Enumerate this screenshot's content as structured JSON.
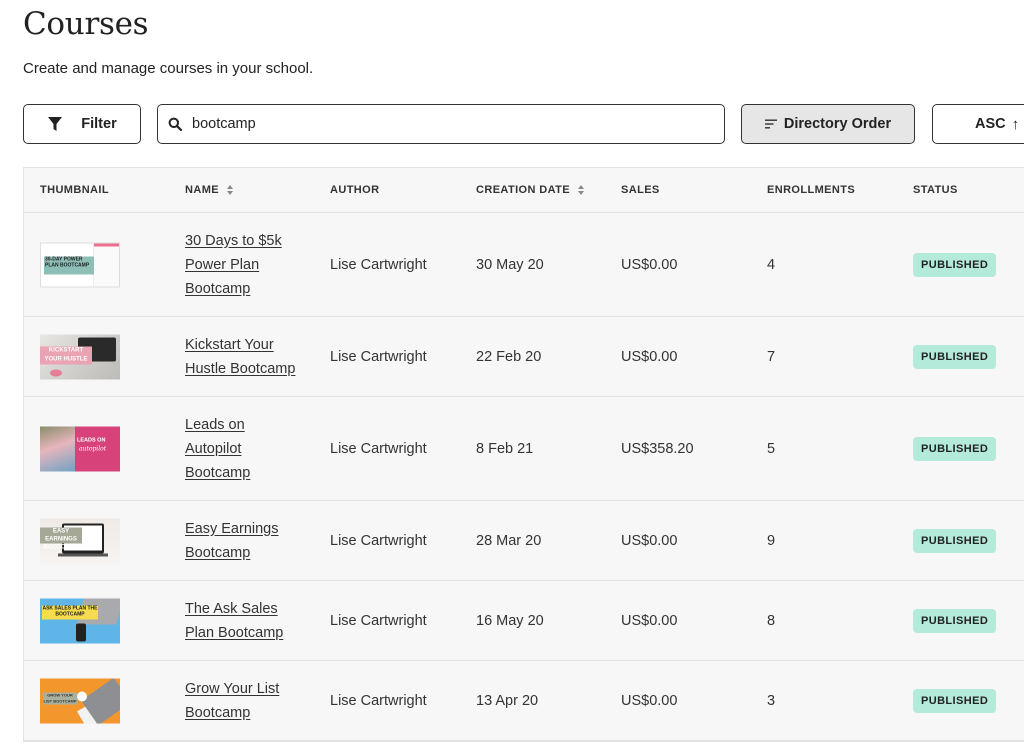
{
  "header": {
    "title": "Courses",
    "subtitle": "Create and manage courses in your school."
  },
  "toolbar": {
    "filter_label": "Filter",
    "search_value": "bootcamp",
    "search_placeholder": "Search",
    "order_label": "Directory Order",
    "direction_label": "ASC",
    "direction_arrow": "↑"
  },
  "table": {
    "columns": {
      "thumbnail": "THUMBNAIL",
      "name": "NAME",
      "author": "AUTHOR",
      "creation_date": "CREATION DATE",
      "sales": "SALES",
      "enrollments": "ENROLLMENTS",
      "status": "STATUS"
    },
    "rows": [
      {
        "name": "30 Days to $5k Power Plan Bootcamp",
        "author": "Lise Cartwright",
        "date": "30 May 20",
        "sales": "US$0.00",
        "enrollments": "4",
        "status": "PUBLISHED",
        "thumb_text": "30-DAY POWER PLAN BOOTCAMP"
      },
      {
        "name": "Kickstart Your Hustle Bootcamp",
        "author": "Lise Cartwright",
        "date": "22 Feb 20",
        "sales": "US$0.00",
        "enrollments": "7",
        "status": "PUBLISHED",
        "thumb_text": "KICKSTART YOUR HUSTLE"
      },
      {
        "name": "Leads on Autopilot Bootcamp",
        "author": "Lise Cartwright",
        "date": "8 Feb 21",
        "sales": "US$358.20",
        "enrollments": "5",
        "status": "PUBLISHED",
        "thumb_text": "LEADS ON",
        "thumb_text2": "autopilot"
      },
      {
        "name": "Easy Earnings Bootcamp",
        "author": "Lise Cartwright",
        "date": "28 Mar 20",
        "sales": "US$0.00",
        "enrollments": "9",
        "status": "PUBLISHED",
        "thumb_text": "EASY EARNINGS BOOTCAMP"
      },
      {
        "name": "The Ask Sales Plan Bootcamp",
        "author": "Lise Cartwright",
        "date": "16 May 20",
        "sales": "US$0.00",
        "enrollments": "8",
        "status": "PUBLISHED",
        "thumb_text": "ASK SALES PLAN THE BOOTCAMP"
      },
      {
        "name": "Grow Your List Bootcamp",
        "author": "Lise Cartwright",
        "date": "13 Apr 20",
        "sales": "US$0.00",
        "enrollments": "3",
        "status": "PUBLISHED",
        "thumb_text": "GROW YOUR LIST BOOTCAMP"
      }
    ]
  },
  "colors": {
    "badge_published": "#b3ead9",
    "table_bg": "#f7f7f7",
    "order_button_bg": "#e6e6e6"
  }
}
